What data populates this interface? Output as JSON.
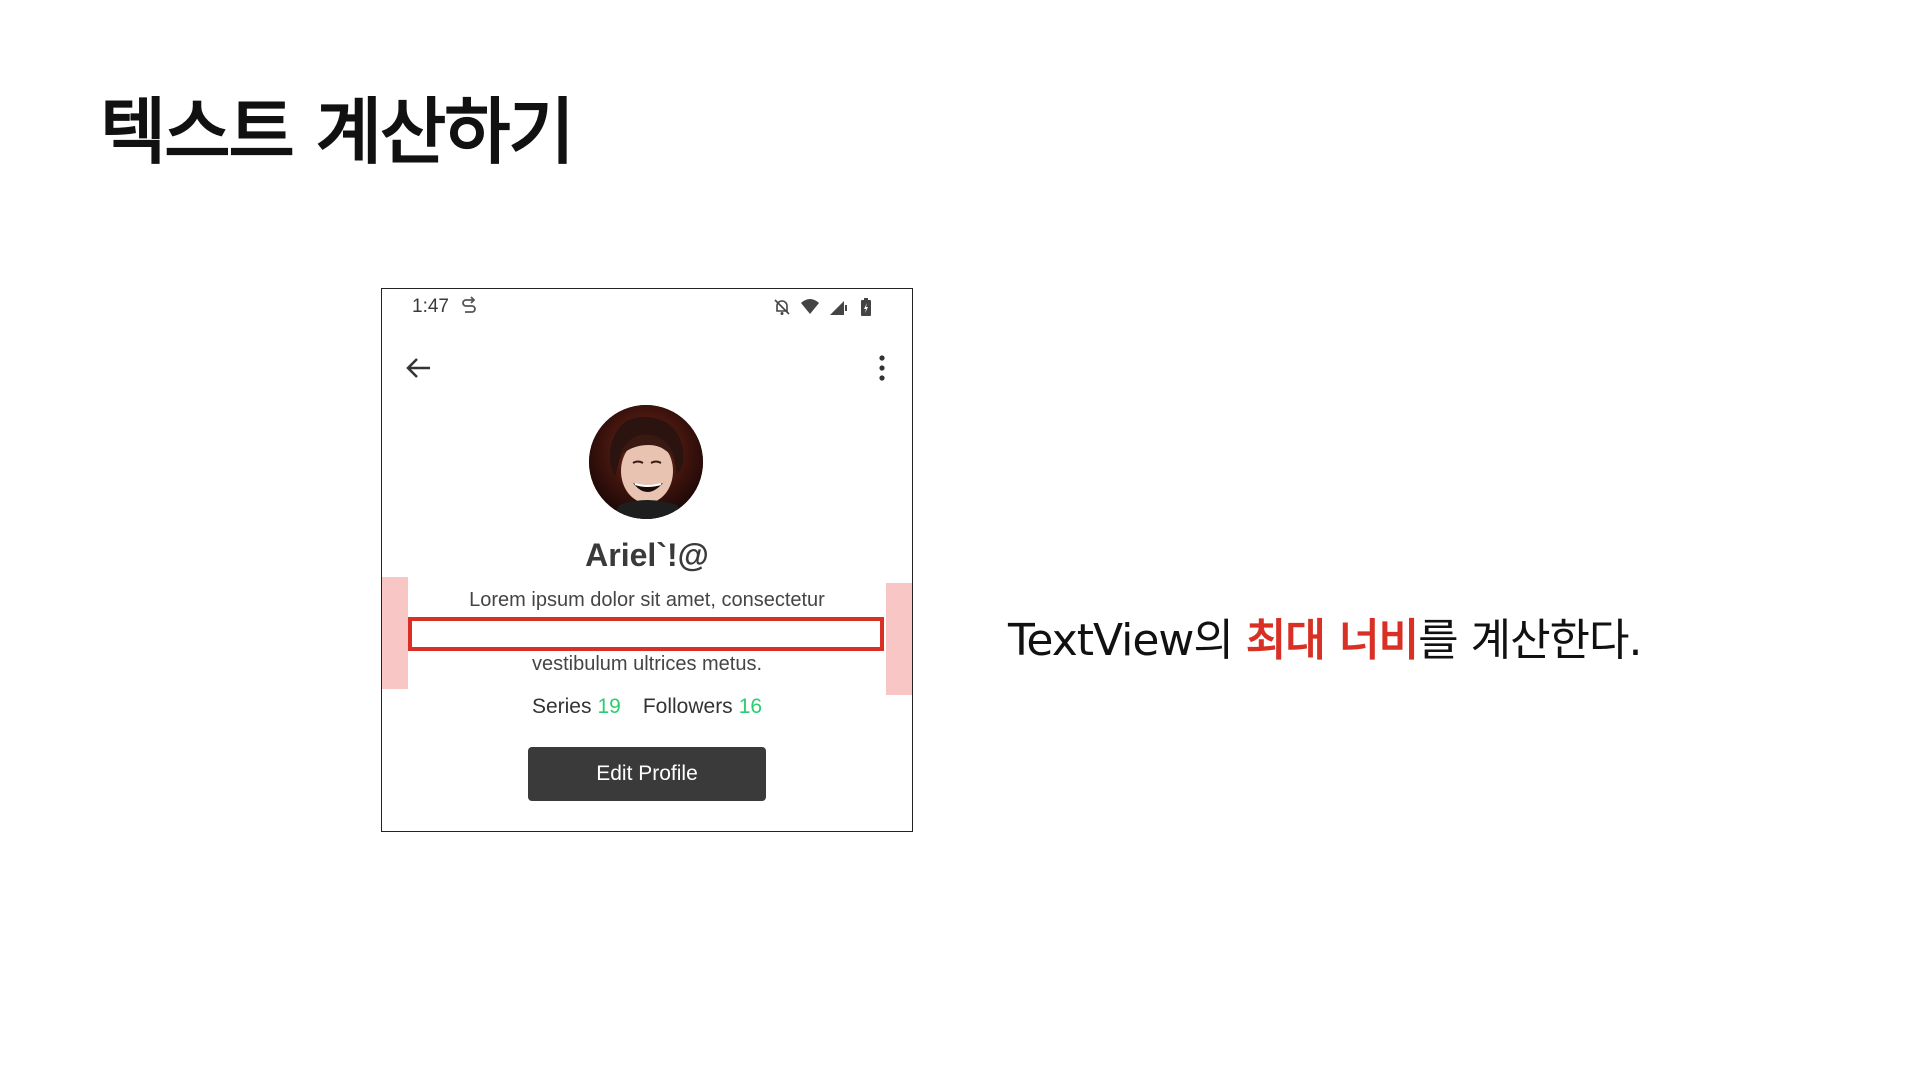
{
  "slide": {
    "title": "텍스트 계산하기"
  },
  "phone": {
    "status_time": "1:47",
    "status_icons": [
      "sync-icon",
      "notifications-off-icon",
      "wifi-icon",
      "signal-icon",
      "battery-charging-icon"
    ],
    "profile_name": "Ariel`!@",
    "bio_line1": "Lorem ipsum dolor sit amet, consectetur",
    "bio_line3": "vestibulum ultrices metus.",
    "series_label": "Series",
    "series_count": "19",
    "followers_label": "Followers",
    "followers_count": "16",
    "edit_button_label": "Edit Profile"
  },
  "caption": {
    "prefix": "TextView의 ",
    "emphasis": "최대 너비",
    "suffix": "를 계산한다."
  },
  "colors": {
    "emphasis": "#d93025",
    "stat_accent": "#2ecc71",
    "padding_highlight": "#f8c6c4",
    "button_bg": "#3a3a3a"
  }
}
